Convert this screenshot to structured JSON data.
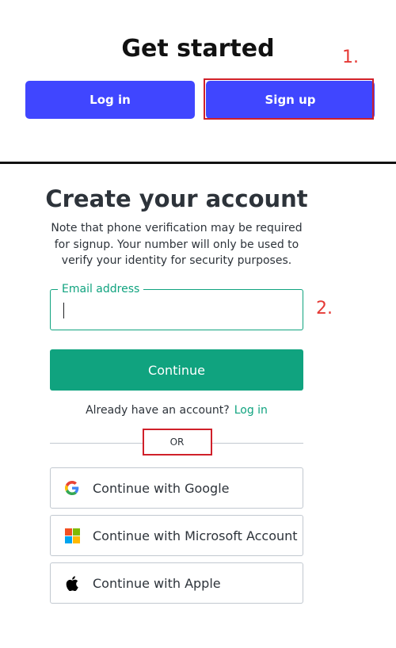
{
  "get_started": {
    "title": "Get started",
    "login_label": "Log in",
    "signup_label": "Sign up",
    "step_marker": "1."
  },
  "create_account": {
    "title": "Create your account",
    "note": "Note that phone verification may be required for signup. Your number will only be used to verify your identity for security purposes.",
    "email_label": "Email address",
    "email_value": "",
    "step_marker": "2.",
    "continue_label": "Continue",
    "already_text": "Already have an account?",
    "login_link": "Log in",
    "or_text": "OR",
    "social": [
      {
        "label": "Continue with Google",
        "icon": "google-icon"
      },
      {
        "label": "Continue with Microsoft Account",
        "icon": "microsoft-icon"
      },
      {
        "label": "Continue with Apple",
        "icon": "apple-icon"
      }
    ]
  },
  "colors": {
    "blue_button": "#4046ff",
    "accent_green": "#10a37f",
    "annotation_red": "#d0202a",
    "text_dark": "#2d333a",
    "border_gray": "#c2c8d0"
  }
}
